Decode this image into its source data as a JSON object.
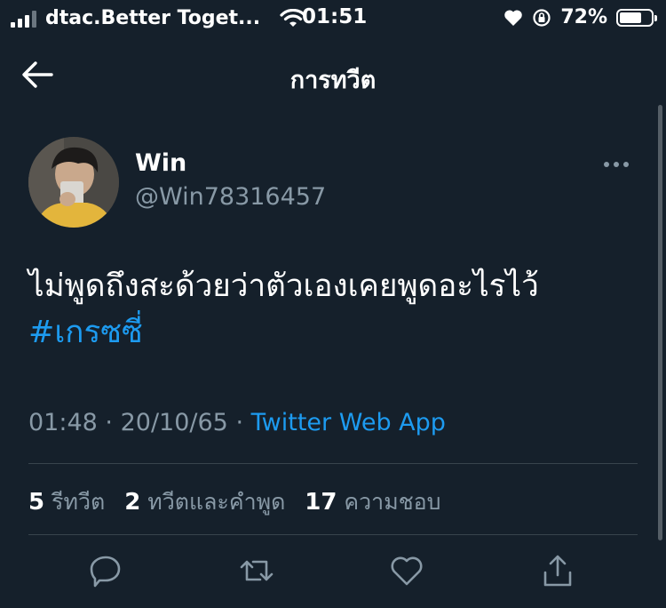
{
  "status_bar": {
    "carrier": "dtac.Better Toget...",
    "time": "01:51",
    "battery_percent": "72%",
    "battery_level": 0.72,
    "icons": [
      "signal-icon",
      "wifi-icon",
      "heart-icon",
      "rotation-lock-icon",
      "battery-icon"
    ]
  },
  "header": {
    "title": "การทวีต",
    "back_icon": "arrow-left-icon"
  },
  "tweet": {
    "display_name": "Win",
    "handle": "@Win78316457",
    "text": "ไม่พูดถึงสะด้วยว่าตัวเองเคยพูดอะไรไว้",
    "hashtag": "#เกรซซี่",
    "time": "01:48",
    "date": "20/10/65",
    "separator": "·",
    "source": "Twitter Web App"
  },
  "stats": {
    "retweets_count": "5",
    "retweets_label": "รีทวีต",
    "quotes_count": "2",
    "quotes_label": "ทวีตและคำพูด",
    "likes_count": "17",
    "likes_label": "ความชอบ"
  },
  "actions": [
    "reply-icon",
    "retweet-icon",
    "like-icon",
    "share-icon"
  ],
  "colors": {
    "background": "#15202b",
    "accent": "#1d9bf0",
    "secondary_text": "#8899a6",
    "divider": "#38444d"
  }
}
